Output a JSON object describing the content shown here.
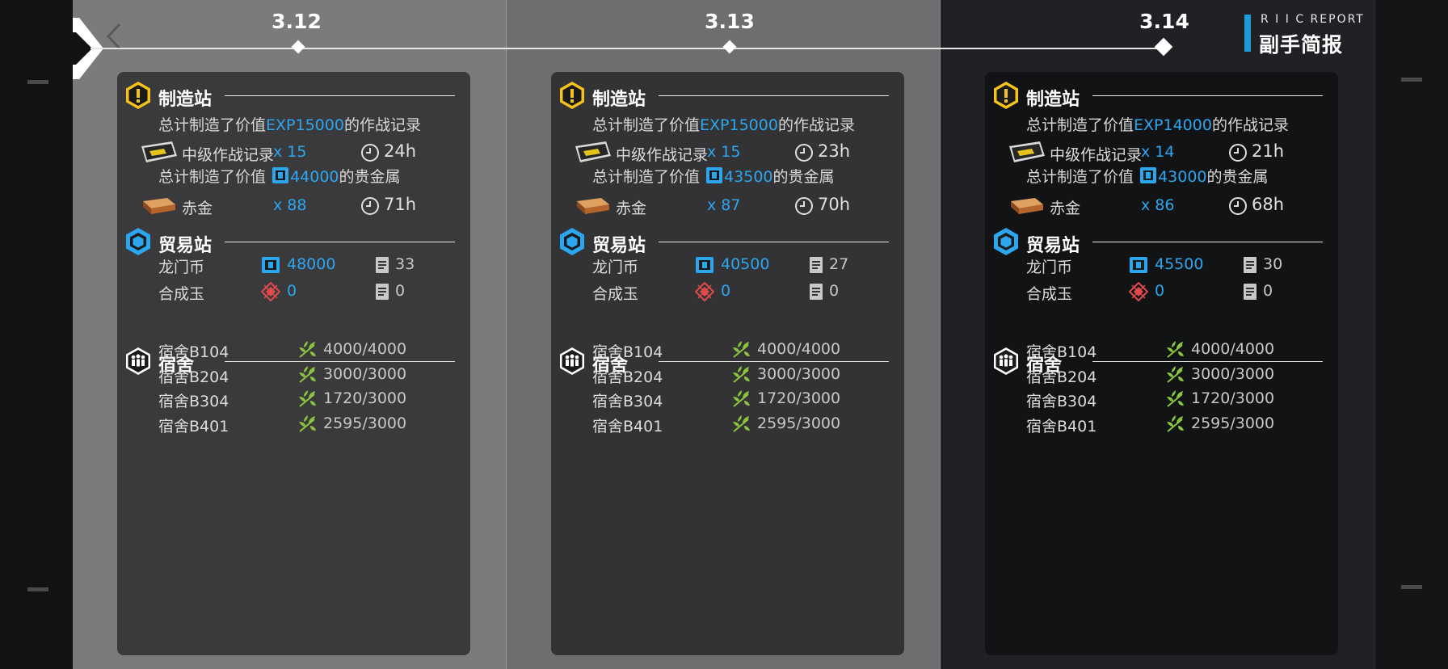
{
  "header": {
    "report_en": "R I I C REPORT",
    "report_cn": "副手简报"
  },
  "timeline": [
    "3.12",
    "3.13",
    "3.14"
  ],
  "accent": "#2da6f0",
  "columns": [
    {
      "date": "3.12",
      "manufacture": {
        "title": "制造站",
        "exp_prefix": "总计制造了价值",
        "exp_value": "EXP15000",
        "exp_suffix": "的作战记录",
        "record_name": "中级作战记录",
        "record_qty": "x 15",
        "record_time": "24h",
        "gold_prefix": "总计制造了价值",
        "gold_value": "44000",
        "gold_suffix": "的贵金属",
        "gold_name": "赤金",
        "gold_qty": "x 88",
        "gold_time": "71h"
      },
      "trade": {
        "title": "贸易站",
        "lmd_name": "龙门币",
        "lmd_value": "48000",
        "lmd_orders": "33",
        "orig_name": "合成玉",
        "orig_value": "0",
        "orig_orders": "0"
      },
      "dorm": {
        "title": "宿舍",
        "rooms": [
          {
            "name": "宿舍B104",
            "mood": "4000/4000"
          },
          {
            "name": "宿舍B204",
            "mood": "3000/3000"
          },
          {
            "name": "宿舍B304",
            "mood": "1720/3000"
          },
          {
            "name": "宿舍B401",
            "mood": "2595/3000"
          }
        ]
      }
    },
    {
      "date": "3.13",
      "manufacture": {
        "title": "制造站",
        "exp_prefix": "总计制造了价值",
        "exp_value": "EXP15000",
        "exp_suffix": "的作战记录",
        "record_name": "中级作战记录",
        "record_qty": "x 15",
        "record_time": "23h",
        "gold_prefix": "总计制造了价值",
        "gold_value": "43500",
        "gold_suffix": "的贵金属",
        "gold_name": "赤金",
        "gold_qty": "x 87",
        "gold_time": "70h"
      },
      "trade": {
        "title": "贸易站",
        "lmd_name": "龙门币",
        "lmd_value": "40500",
        "lmd_orders": "27",
        "orig_name": "合成玉",
        "orig_value": "0",
        "orig_orders": "0"
      },
      "dorm": {
        "title": "宿舍",
        "rooms": [
          {
            "name": "宿舍B104",
            "mood": "4000/4000"
          },
          {
            "name": "宿舍B204",
            "mood": "3000/3000"
          },
          {
            "name": "宿舍B304",
            "mood": "1720/3000"
          },
          {
            "name": "宿舍B401",
            "mood": "2595/3000"
          }
        ]
      }
    },
    {
      "date": "3.14",
      "manufacture": {
        "title": "制造站",
        "exp_prefix": "总计制造了价值",
        "exp_value": "EXP14000",
        "exp_suffix": "的作战记录",
        "record_name": "中级作战记录",
        "record_qty": "x 14",
        "record_time": "21h",
        "gold_prefix": "总计制造了价值",
        "gold_value": "43000",
        "gold_suffix": "的贵金属",
        "gold_name": "赤金",
        "gold_qty": "x 86",
        "gold_time": "68h"
      },
      "trade": {
        "title": "贸易站",
        "lmd_name": "龙门币",
        "lmd_value": "45500",
        "lmd_orders": "30",
        "orig_name": "合成玉",
        "orig_value": "0",
        "orig_orders": "0"
      },
      "dorm": {
        "title": "宿舍",
        "rooms": [
          {
            "name": "宿舍B104",
            "mood": "4000/4000"
          },
          {
            "name": "宿舍B204",
            "mood": "3000/3000"
          },
          {
            "name": "宿舍B304",
            "mood": "1720/3000"
          },
          {
            "name": "宿舍B401",
            "mood": "2595/3000"
          }
        ]
      }
    }
  ]
}
